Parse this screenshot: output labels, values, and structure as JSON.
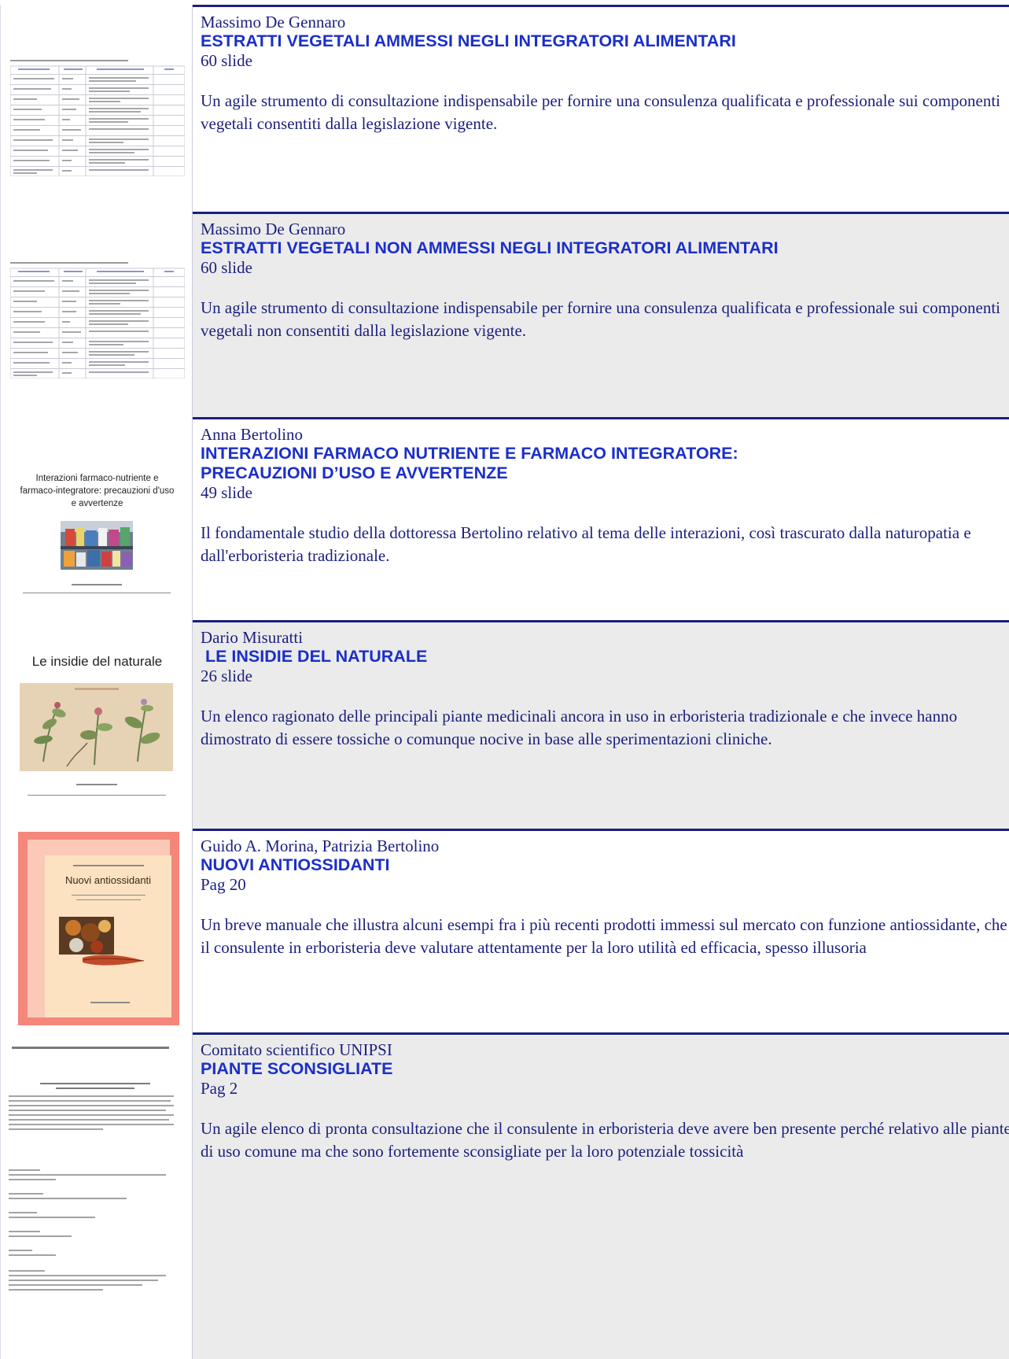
{
  "entries": [
    {
      "author": "Massimo De Gennaro",
      "title": "ESTRATTI VEGETALI AMMESSI NEGLI INTEGRATORI ALIMENTARI",
      "meta": "60 slide",
      "description": "Un agile strumento di consultazione indispensabile per fornire una consulenza qualificata e professionale sui componenti vegetali consentiti dalla legislazione vigente."
    },
    {
      "author": "Massimo De Gennaro",
      "title": "ESTRATTI VEGETALI NON AMMESSI NEGLI INTEGRATORI ALIMENTARI",
      "meta": "60 slide",
      "description": "Un agile strumento di consultazione indispensabile per fornire una consulenza qualificata e professionale sui componenti vegetali non consentiti dalla legislazione vigente."
    },
    {
      "author": "Anna Bertolino",
      "title": "INTERAZIONI FARMACO NUTRIENTE E FARMACO INTEGRATORE:\nPRECAUZIONI D’USO E AVVERTENZE",
      "meta": "49 slide",
      "description": "Il fondamentale studio della dottoressa Bertolino relativo al tema delle interazioni, così trascurato dalla naturopatia e dall'erboristeria tradizionale.",
      "thumbnail_title": "Interazioni farmaco-nutriente e farmaco-integratore: precauzioni d'uso e avvertenze"
    },
    {
      "author": "Dario Misuratti",
      "title": " LE INSIDIE DEL NATURALE",
      "meta": "26 slide",
      "description": "Un elenco ragionato delle principali piante medicinali ancora in uso in erboristeria tradizionale e che invece hanno dimostrato di essere tossiche o comunque nocive in base alle sperimentazioni cliniche.",
      "thumbnail_title": "Le insidie del naturale"
    },
    {
      "author": "Guido A. Morina, Patrizia Bertolino",
      "title": "NUOVI ANTIOSSIDANTI",
      "meta": "Pag 20",
      "description": "Un breve manuale che illustra alcuni esempi fra i più recenti prodotti immessi sul mercato con funzione antiossidante, che il consulente in erboristeria deve valutare attentamente per la loro utilità ed efficacia, spesso illusoria",
      "thumbnail_title": "Nuovi antiossidanti"
    },
    {
      "author": "Comitato scientifico UNIPSI",
      "title": "PIANTE SCONSIGLIATE",
      "meta": "Pag 2",
      "description": "Un agile elenco di pronta consultazione che il consulente in erboristeria deve avere ben presente perché relativo alle piante di uso comune ma che sono fortemente sconsigliate per la loro potenziale tossicità"
    }
  ]
}
